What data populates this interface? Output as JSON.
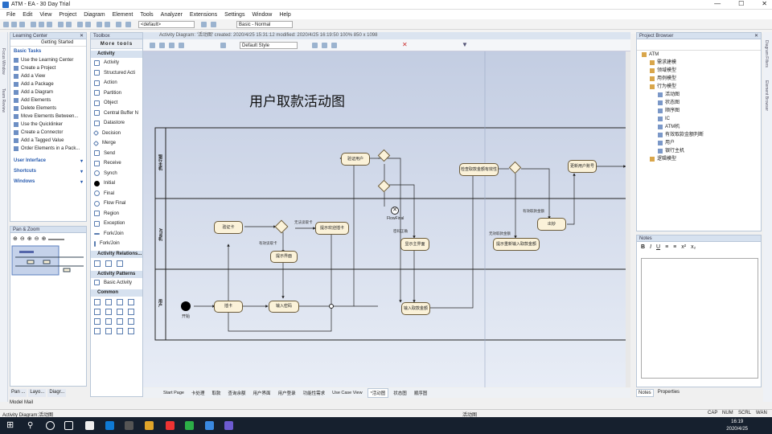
{
  "window": {
    "title": "ATM - EA - 30 Day Trial",
    "controls": [
      "—",
      "☐",
      "✕"
    ]
  },
  "menu": [
    "File",
    "Edit",
    "View",
    "Project",
    "Diagram",
    "Element",
    "Tools",
    "Analyzer",
    "Extensions",
    "Settings",
    "Window",
    "Help"
  ],
  "toolbar": {
    "default_combo": "<default>",
    "style_combo": "Basic - Normal"
  },
  "learning_center": {
    "title": "Learning Center",
    "search": "Getting Started",
    "basic_tasks_label": "Basic Tasks",
    "items": [
      "Use the Learning Center",
      "Create a Project",
      "Add a View",
      "Add a Package",
      "Add a Diagram",
      "Add Elements",
      "Delete Elements",
      "Move Elements Between...",
      "Use the Quicklinker",
      "Create a Connector",
      "Add a Tagged Value",
      "Order Elements in a Pack..."
    ],
    "sections": [
      "User Interface",
      "Shortcuts",
      "Windows"
    ]
  },
  "pan_zoom": {
    "title": "Pan & Zoom"
  },
  "left_tabs": [
    "Pan ...",
    "Layo...",
    "Diagr..."
  ],
  "model_mail": "Model Mail",
  "side_strip": [
    "Focus Window",
    "Team Review"
  ],
  "toolbox": {
    "title": "Toolbox",
    "header": "More tools",
    "activity_section": "Activity",
    "activity_items": [
      "Activity",
      "Structured Acti",
      "Action",
      "Partition",
      "Object",
      "Central Buffer N",
      "Datastore",
      "Decision",
      "Merge",
      "Send",
      "Receive",
      "Synch",
      "Initial",
      "Final",
      "Flow Final",
      "Region",
      "Exception",
      "Fork/Join",
      "Fork/Join"
    ],
    "relations_section": "Activity Relations...",
    "patterns_section": "Activity Patterns",
    "patterns_items": [
      "Basic Activity"
    ],
    "common_section": "Common"
  },
  "diagram": {
    "header": "Activity Diagram: '活动图'  created: 2020/4/25 15:31:12  modified: 2020/4/25 16:19:50  100%  850 x 1098",
    "style_combo": "Default Style",
    "title": "用户取款活动图",
    "lanes": [
      "银行主机",
      "ATM机",
      "用户"
    ],
    "nodes": {
      "validate_user": "验证用户",
      "validate_card": "验证卡",
      "show_welcome": "提示欢迎插卡",
      "show_message": "提示界面",
      "insert_card": "插卡",
      "input_password": "输入密码",
      "show_main": "显示主界面",
      "input_amount": "输入取款金额",
      "check_amount": "检查取款金额有效性",
      "reinput_amount": "提示重新输入取款金额",
      "dispense": "出钞",
      "update_account": "更新用户账号",
      "start_label": "开始",
      "flow_final_label": "FlowFinal"
    },
    "edge_labels": [
      "无法读取卡",
      "有效读取卡",
      "密码正确",
      "有效取款金额",
      "无效取款金额"
    ],
    "tabs": [
      "Start Page",
      "卡处理",
      "取款",
      "查询余额",
      "用户界面",
      "用户登录",
      "功能性需求",
      "Use Case View",
      "*活动图",
      "状态图",
      "顺序图"
    ],
    "active_tab": "*活动图"
  },
  "project_browser": {
    "title": "Project Browser",
    "tree": [
      {
        "label": "ATM",
        "depth": 0
      },
      {
        "label": "需求建模",
        "depth": 1
      },
      {
        "label": "领域模型",
        "depth": 1
      },
      {
        "label": "用例模型",
        "depth": 1
      },
      {
        "label": "行为模型",
        "depth": 1
      },
      {
        "label": "活动图",
        "depth": 2
      },
      {
        "label": "状态图",
        "depth": 2
      },
      {
        "label": "顺序图",
        "depth": 2
      },
      {
        "label": "IC",
        "depth": 2
      },
      {
        "label": "ATM机",
        "depth": 2
      },
      {
        "label": "有效取款金额判断",
        "depth": 2
      },
      {
        "label": "用户",
        "depth": 2
      },
      {
        "label": "银行主机",
        "depth": 2
      },
      {
        "label": "逻辑模型",
        "depth": 1
      }
    ]
  },
  "notes": {
    "title": "Notes"
  },
  "right_tabs": [
    "Notes",
    "Properties"
  ],
  "right_strip": [
    "Diagram Filters",
    "Element Browser"
  ],
  "status": {
    "left": "Activity Diagram:活动图",
    "center": "活动图",
    "right": [
      "CAP",
      "NUM",
      "SCRL",
      "WAN"
    ]
  },
  "taskbar": {
    "time": "16:19",
    "date": "2020/4/25"
  }
}
